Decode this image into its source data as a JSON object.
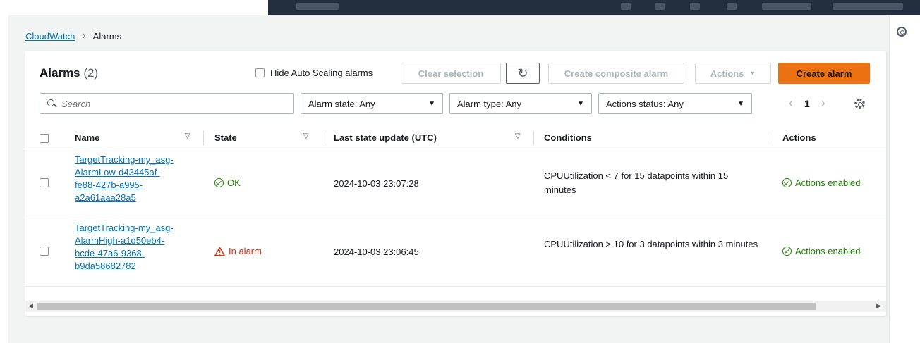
{
  "breadcrumb": {
    "root": "CloudWatch",
    "current": "Alarms"
  },
  "header": {
    "title": "Alarms",
    "count": "(2)"
  },
  "toolbar": {
    "hide_autoscaling": "Hide Auto Scaling alarms",
    "clear_selection": "Clear selection",
    "refresh_icon": "refresh-icon",
    "create_composite": "Create composite alarm",
    "actions": "Actions",
    "create_alarm": "Create alarm"
  },
  "filters": {
    "search_placeholder": "Search",
    "alarm_state": "Alarm state: Any",
    "alarm_type": "Alarm type: Any",
    "actions_status": "Actions status: Any"
  },
  "pagination": {
    "page": "1"
  },
  "columns": [
    "Name",
    "State",
    "Last state update (UTC)",
    "Conditions",
    "Actions"
  ],
  "rows": [
    {
      "name_lines": [
        "TargetTracking-my_asg-",
        "AlarmLow-d43445af-",
        "fe88-427b-a995-",
        "a2a61aaa28a5"
      ],
      "state": "OK",
      "last_update": "2024-10-03 23:07:28",
      "conditions": "CPUUtilization < 7 for 15 datapoints within 15 minutes",
      "actions": "Actions enabled"
    },
    {
      "name_lines": [
        "TargetTracking-my_asg-",
        "AlarmHigh-a1d50eb4-",
        "bcde-47a6-9368-",
        "b9da58682782"
      ],
      "state": "In alarm",
      "last_update": "2024-10-03 23:06:45",
      "conditions": "CPUUtilization > 10 for 3 datapoints within 3 minutes",
      "actions": "Actions enabled"
    }
  ],
  "colors": {
    "accent": "#ec7211",
    "link": "#0073bb",
    "ok": "#1d8102",
    "alarm": "#d13212",
    "nav": "#232f3e"
  }
}
